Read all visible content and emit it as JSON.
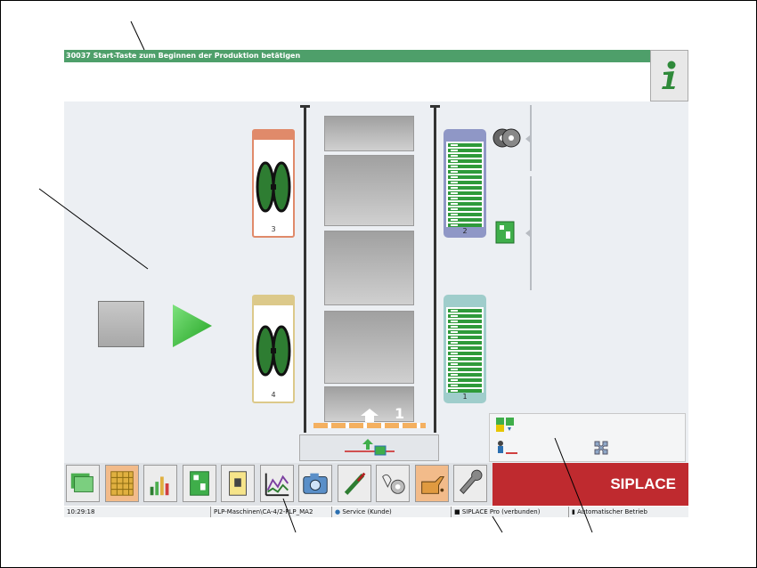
{
  "message": {
    "text": "30037 Start-Taste zum Beginnen der Produktion betätigen"
  },
  "info_button": {
    "icon": "info-icon"
  },
  "heads": [
    {
      "number": "3",
      "color": "#e08a6a"
    },
    {
      "number": "4",
      "color": "#dcc98a"
    }
  ],
  "feeders": [
    {
      "number": "2",
      "color": "#8f97c6"
    },
    {
      "number": "1",
      "color": "#9fcdcb"
    }
  ],
  "conveyor": {
    "lane_number": "1"
  },
  "controls": {
    "stop_icon": "stop-icon",
    "start_icon": "play-icon"
  },
  "toolbar": {
    "buttons": [
      {
        "icon": "stack-icon"
      },
      {
        "icon": "feeder-grid-icon"
      },
      {
        "icon": "bar-graph-icon"
      },
      {
        "icon": "board-icon"
      },
      {
        "icon": "document-icon"
      },
      {
        "icon": "chart-icon"
      },
      {
        "icon": "camera-icon"
      },
      {
        "icon": "screwdriver-icon"
      },
      {
        "icon": "hand-gear-icon"
      },
      {
        "icon": "oil-can-icon"
      },
      {
        "icon": "wrench-icon"
      }
    ]
  },
  "brand": {
    "label": "SIPLACE"
  },
  "statusbar": {
    "time": "10:29:18",
    "path": "PLP-Maschinen\\CA-4/2-PLP_MA2",
    "user": "Service (Kunde)",
    "connection": "SIPLACE Pro (verbunden)",
    "mode": "Automatischer Betrieb"
  },
  "colors": {
    "message_bar": "#4e9f6a",
    "brand": "#bf2a2f",
    "selected_button": "#f2bb8a",
    "start_arrow": "#3fbf3f"
  }
}
